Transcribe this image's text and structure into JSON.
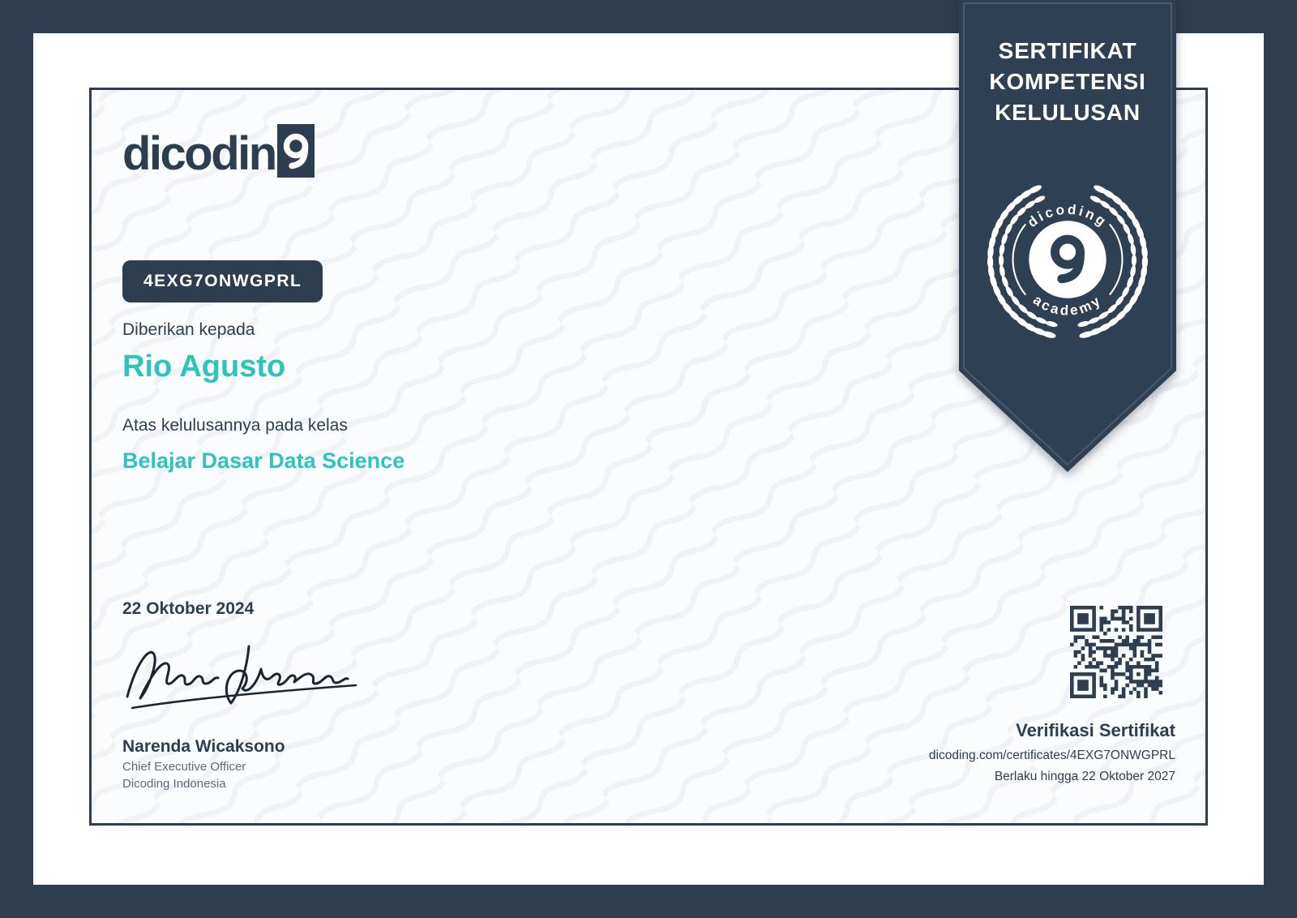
{
  "colors": {
    "navy": "#2D3E50",
    "ribbon_navy": "#2E4154",
    "teal": "#2CC5BC",
    "muted_text": "#5E6A75",
    "paper": "#FBFCFE",
    "pattern_line": "#EDEFF3"
  },
  "logo": {
    "wordmark_prefix": "dicodin",
    "wordmark_suffix": "g"
  },
  "ribbon": {
    "lines": [
      "SERTIFIKAT",
      "KOMPETENSI",
      "KELULUSAN"
    ]
  },
  "badge": {
    "top_text": "dicoding",
    "center_glyph": "9",
    "bottom_text": "academy"
  },
  "certificate": {
    "code": "4EXG7ONWGPRL",
    "given_to_label": "Diberikan kepada",
    "recipient_name": "Rio Agusto",
    "course_label": "Atas kelulusannya pada kelas",
    "course_title": "Belajar Dasar Data Science",
    "issue_date": "22 Oktober 2024"
  },
  "signer": {
    "name": "Narenda Wicaksono",
    "title": "Chief Executive Officer",
    "organization": "Dicoding Indonesia"
  },
  "verification": {
    "heading": "Verifikasi Sertifikat",
    "url": "dicoding.com/certificates/4EXG7ONWGPRL",
    "validity": "Berlaku hingga 22 Oktober 2027"
  },
  "icons": {
    "badge": "laurel-wreath-icon",
    "qr": "qr-code-icon",
    "signature": "signature-icon",
    "logo_g": "dicoding-g-icon"
  }
}
